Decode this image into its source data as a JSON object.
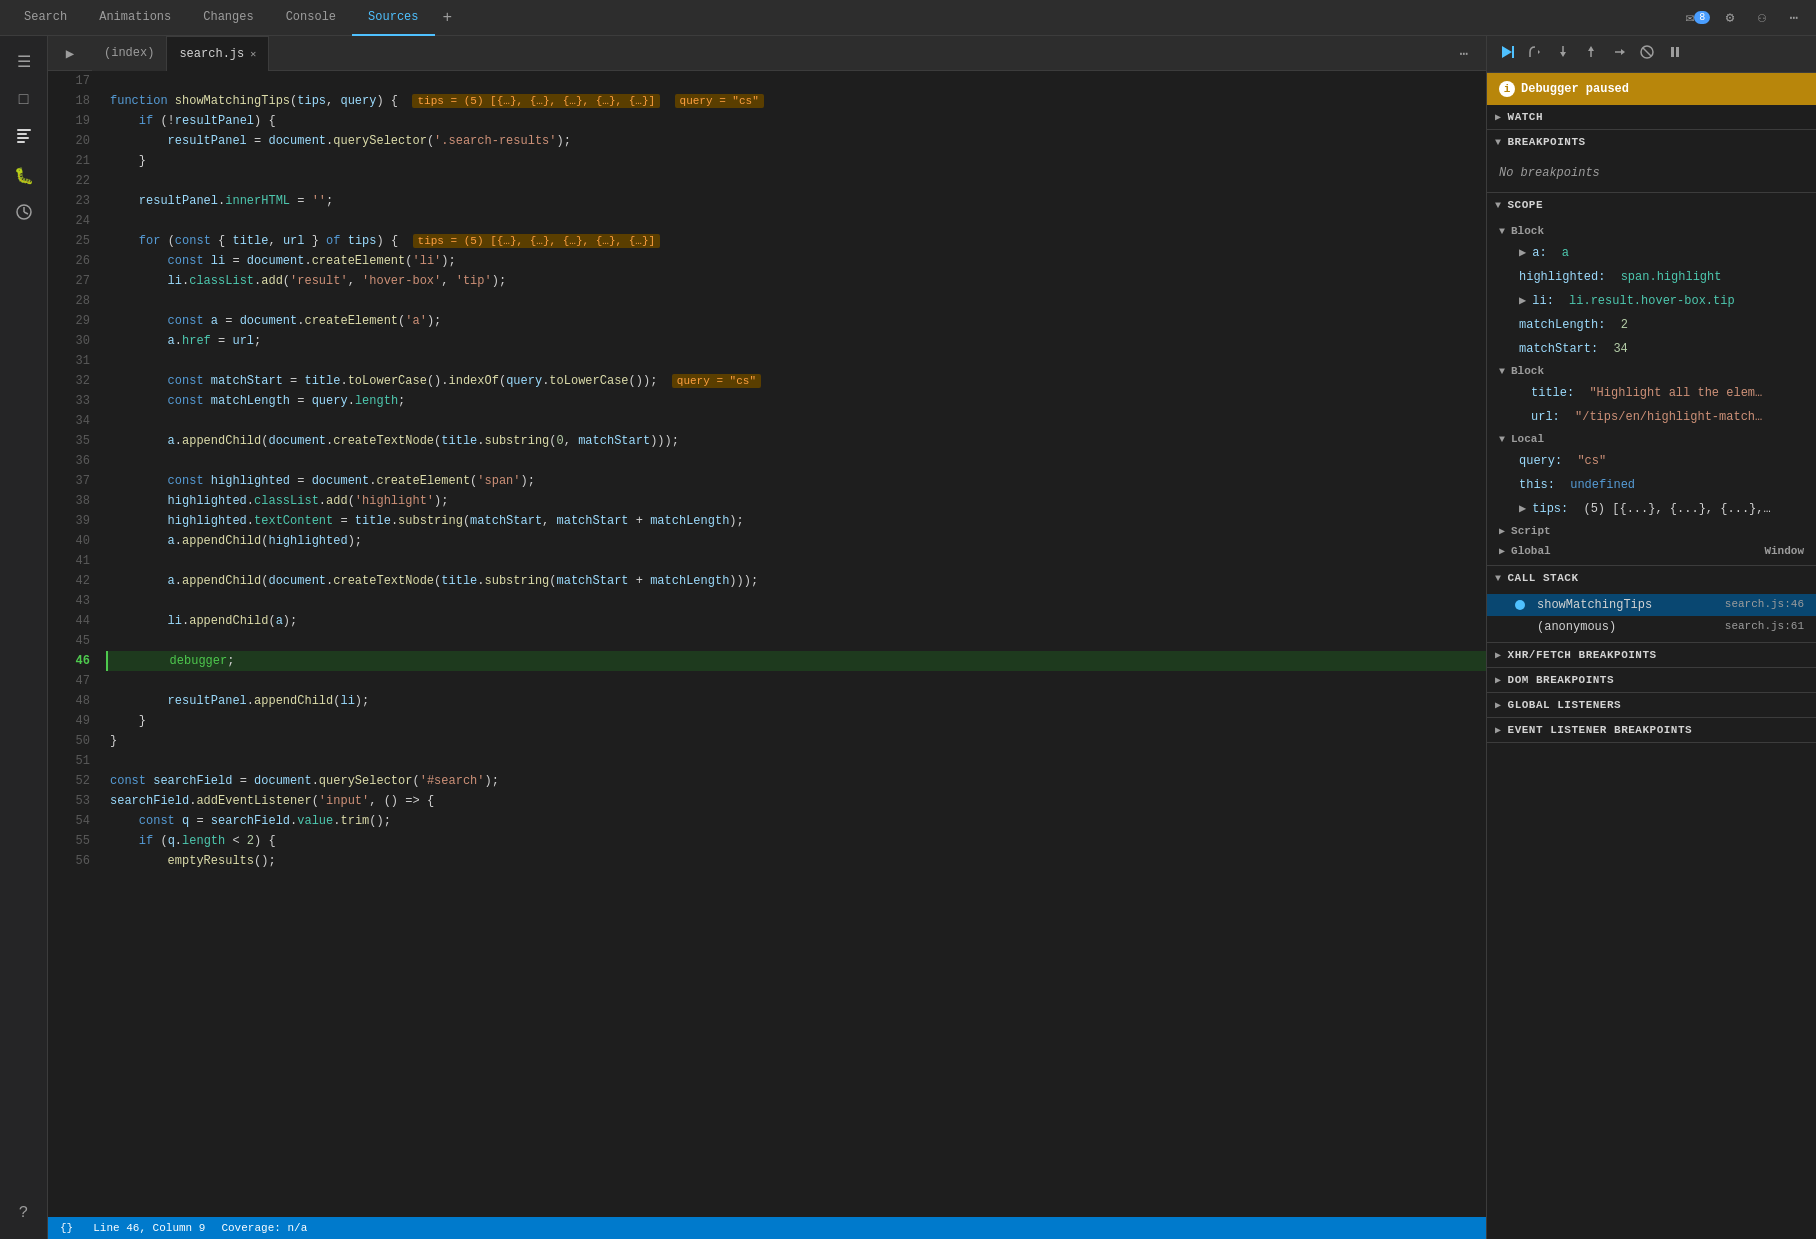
{
  "tabs": {
    "items": [
      {
        "label": "Search",
        "active": false
      },
      {
        "label": "Animations",
        "active": false
      },
      {
        "label": "Changes",
        "active": false
      },
      {
        "label": "Console",
        "active": false
      },
      {
        "label": "Sources",
        "active": true
      }
    ],
    "add_label": "+",
    "badge_count": "8"
  },
  "toolbar": {
    "gear_label": "⚙",
    "person_label": "⚇",
    "more_label": "⋯"
  },
  "file_tabs": {
    "items": [
      {
        "label": "(index)",
        "active": false
      },
      {
        "label": "search.js",
        "active": true,
        "closeable": true
      }
    ],
    "play_icon": "▶",
    "more_icon": "⋯"
  },
  "code": {
    "lines": [
      {
        "num": 17,
        "content": ""
      },
      {
        "num": 18,
        "content": "function showMatchingTips(tips, query) {",
        "has_tips_tag": true,
        "has_query_tag": true
      },
      {
        "num": 19,
        "content": "    if (!resultPanel) {"
      },
      {
        "num": 20,
        "content": "        resultPanel = document.querySelector('.search-results');"
      },
      {
        "num": 21,
        "content": "    }"
      },
      {
        "num": 22,
        "content": ""
      },
      {
        "num": 23,
        "content": "    resultPanel.innerHTML = '';"
      },
      {
        "num": 24,
        "content": ""
      },
      {
        "num": 25,
        "content": "    for (const { title, url } of tips) {",
        "has_tips_tag2": true
      },
      {
        "num": 26,
        "content": "        const li = document.createElement('li');"
      },
      {
        "num": 27,
        "content": "        li.classList.add('result', 'hover-box', 'tip');"
      },
      {
        "num": 28,
        "content": ""
      },
      {
        "num": 29,
        "content": "        const a = document.createElement('a');"
      },
      {
        "num": 30,
        "content": "        a.href = url;"
      },
      {
        "num": 31,
        "content": ""
      },
      {
        "num": 32,
        "content": "        const matchStart = title.toLowerCase().indexOf(query.toLowerCase());",
        "has_query_tag2": true
      },
      {
        "num": 33,
        "content": "        const matchLength = query.length;"
      },
      {
        "num": 34,
        "content": ""
      },
      {
        "num": 35,
        "content": "        a.appendChild(document.createTextNode(title.substring(0, matchStart)));"
      },
      {
        "num": 36,
        "content": ""
      },
      {
        "num": 37,
        "content": "        const highlighted = document.createElement('span');"
      },
      {
        "num": 38,
        "content": "        highlighted.classList.add('highlight');"
      },
      {
        "num": 39,
        "content": "        highlighted.textContent = title.substring(matchStart, matchStart + matchLength);"
      },
      {
        "num": 40,
        "content": "        a.appendChild(highlighted);"
      },
      {
        "num": 41,
        "content": ""
      },
      {
        "num": 42,
        "content": "        a.appendChild(document.createTextNode(title.substring(matchStart + matchLength)));"
      },
      {
        "num": 43,
        "content": ""
      },
      {
        "num": 44,
        "content": "        li.appendChild(a);"
      },
      {
        "num": 45,
        "content": ""
      },
      {
        "num": 46,
        "content": "        debugger;",
        "debugger": true
      },
      {
        "num": 47,
        "content": ""
      },
      {
        "num": 48,
        "content": "        resultPanel.appendChild(li);"
      },
      {
        "num": 49,
        "content": "    }"
      },
      {
        "num": 50,
        "content": "}"
      },
      {
        "num": 51,
        "content": ""
      },
      {
        "num": 52,
        "content": "const searchField = document.querySelector('#search');"
      },
      {
        "num": 53,
        "content": "searchField.addEventListener('input', () => {"
      },
      {
        "num": 54,
        "content": "    const q = searchField.value.trim();"
      },
      {
        "num": 55,
        "content": "    if (q.length < 2) {"
      },
      {
        "num": 56,
        "content": "        emptyResults();"
      }
    ]
  },
  "status_bar": {
    "curly": "{}",
    "position": "Line 46, Column 9",
    "coverage": "Coverage: n/a"
  },
  "right_panel": {
    "debugger_paused": "Debugger paused",
    "watch_label": "Watch",
    "breakpoints_label": "Breakpoints",
    "no_breakpoints": "No breakpoints",
    "scope_label": "Scope",
    "scope_block1_label": "Block",
    "scope_block2_label": "Block",
    "scope_local_label": "Local",
    "scope_script_label": "Script",
    "scope_global_label": "Global",
    "scope_global_val": "Window",
    "scope_items": [
      {
        "key": "▶ a:",
        "val": "a",
        "indent": 1
      },
      {
        "key": "highlighted:",
        "val": "span.highlight",
        "indent": 1,
        "val_class": true
      },
      {
        "key": "▶ li:",
        "val": "li.result.hover-box.tip",
        "indent": 1,
        "val_class": true
      },
      {
        "key": "matchLength:",
        "val": "2",
        "indent": 1,
        "is_num": true
      },
      {
        "key": "matchStart:",
        "val": "34",
        "indent": 1,
        "is_num": true
      },
      {
        "key": "title:",
        "val": "\"Highlight all the elem...",
        "indent": 2
      },
      {
        "key": "url:",
        "val": "\"/tips/en/highlight-match...",
        "indent": 2
      },
      {
        "key": "query:",
        "val": "\"cs\"",
        "indent": 1
      },
      {
        "key": "this:",
        "val": "undefined",
        "indent": 1,
        "is_undef": true
      },
      {
        "key": "▶ tips:",
        "val": "(5) [{...}, {...}, {...},..…",
        "indent": 1
      }
    ],
    "call_stack_label": "Call Stack",
    "call_stack_items": [
      {
        "fn": "showMatchingTips",
        "ref": "search.js:46",
        "active": true
      },
      {
        "fn": "(anonymous)",
        "ref": "search.js:61",
        "active": false
      }
    ],
    "xhr_label": "XHR/fetch Breakpoints",
    "dom_label": "DOM Breakpoints",
    "global_listeners_label": "Global Listeners",
    "event_listener_label": "Event Listener Breakpoints"
  },
  "activity_bar": {
    "items": [
      {
        "icon": "☰",
        "name": "menu"
      },
      {
        "icon": "⬡",
        "name": "inspector"
      },
      {
        "icon": "⊕",
        "name": "console"
      },
      {
        "icon": "⚡",
        "name": "sources"
      },
      {
        "icon": "◉",
        "name": "debugger"
      },
      {
        "icon": "⊞",
        "name": "performance"
      }
    ]
  }
}
